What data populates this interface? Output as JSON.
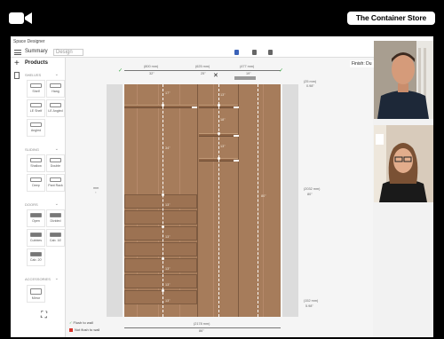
{
  "brand": {
    "name": "The Container Store"
  },
  "app": {
    "title": "Space Designer",
    "tabs": {
      "summary": "Summary",
      "design": "Design"
    },
    "finish_label": "Finish: Du"
  },
  "sidebar": {
    "title": "Products",
    "sections": [
      {
        "label": "SHELVES",
        "items": [
          "Shelf",
          "Hang",
          "LE Shelf",
          "LE Angled",
          "Angled"
        ]
      },
      {
        "label": "SLIDING",
        "items": [
          "Shallow",
          "Double",
          "Deep",
          "Pant Rack"
        ]
      },
      {
        "label": "DOORS",
        "items": [
          "Open",
          "Divided",
          "Cubbies",
          "Cab. 16'",
          "Cab. 20'"
        ]
      },
      {
        "label": "ACCESSORIES",
        "items": [
          "Mirror"
        ]
      }
    ]
  },
  "dimensions": {
    "top": [
      "(800 mm)",
      "(625 mm)",
      "(477 mm)"
    ],
    "top_inches": [
      "32\"",
      "25\"",
      "19\""
    ],
    "right_top": [
      "(25 mm)",
      "0.98\""
    ],
    "left_side": [
      "mm",
      "\""
    ],
    "right_middle": [
      "(2032 mm)",
      "80\""
    ],
    "right_bottom": [
      "(152 mm)",
      "5.98\""
    ],
    "bottom": [
      "(2178 mm)",
      "86\""
    ],
    "inner_labels": [
      "17\"",
      "13\"",
      "18\"",
      "34\"",
      "13\"",
      "13\"",
      "80\"",
      "13\"",
      "13\"",
      "13\"",
      "13\""
    ]
  },
  "legend": {
    "flush": "Flush to wall",
    "not_flush": "Not flush to wall"
  },
  "colors": {
    "flush_check": "#3fae49",
    "not_flush": "#d9342b",
    "wood": "#a67c5b",
    "accent": "#3b62b8"
  },
  "icons": [
    "video-camera-icon",
    "menu-icon",
    "plus-icon",
    "expand-icon",
    "check-icon",
    "close-icon"
  ]
}
